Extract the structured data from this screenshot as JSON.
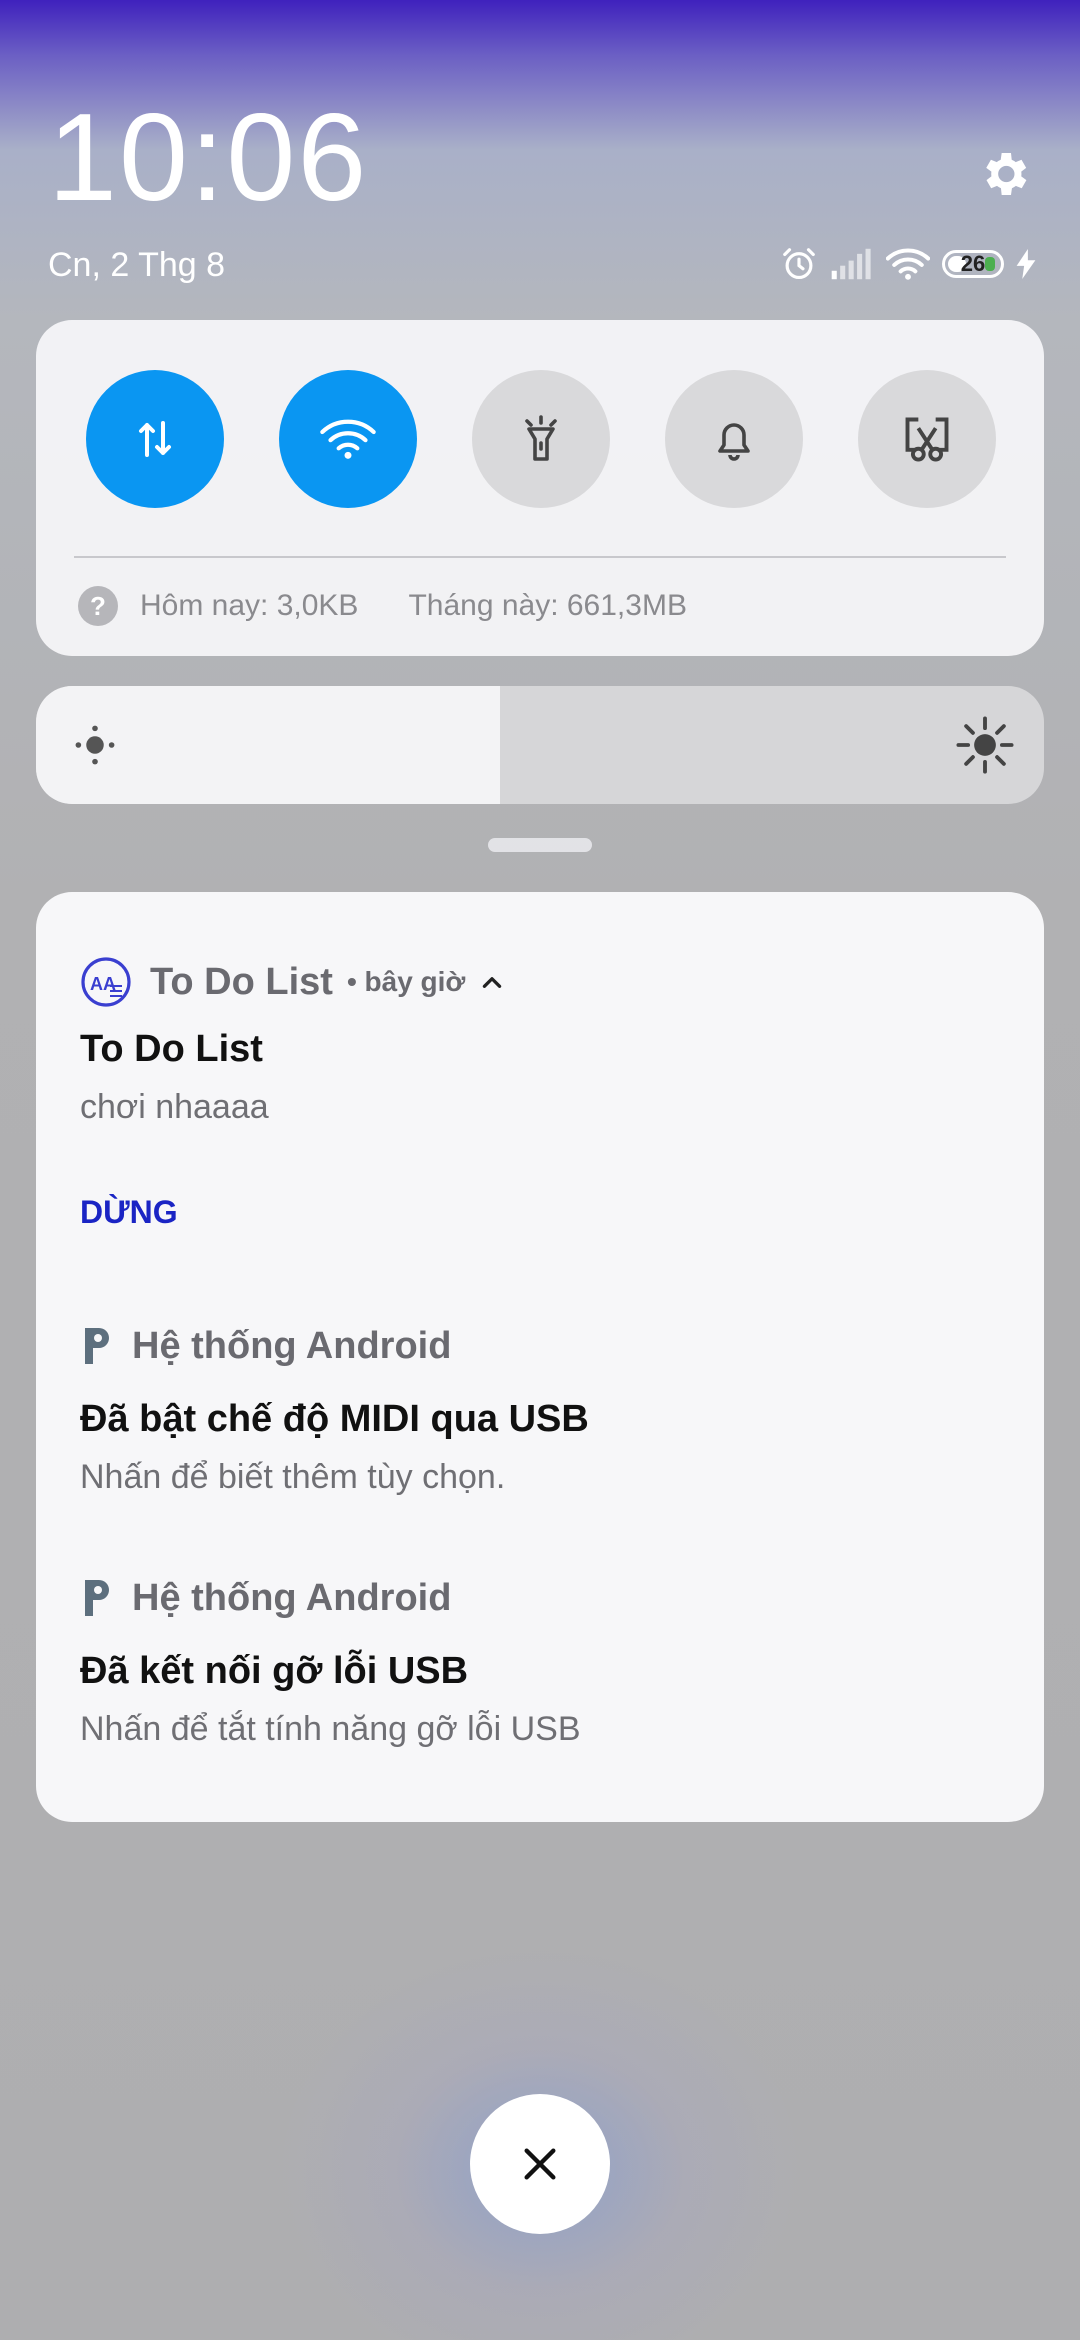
{
  "header": {
    "time": "10:06",
    "date": "Cn, 2 Thg 8",
    "battery_level": "26"
  },
  "quick_settings": {
    "toggles": [
      {
        "name": "mobile-data",
        "icon": "data-arrows-icon",
        "on": true
      },
      {
        "name": "wifi",
        "icon": "wifi-icon",
        "on": true
      },
      {
        "name": "flashlight",
        "icon": "flashlight-icon",
        "on": false
      },
      {
        "name": "notifications-sound",
        "icon": "bell-icon",
        "on": false
      },
      {
        "name": "screenshot",
        "icon": "screenshot-scissors-icon",
        "on": false
      }
    ],
    "usage_today": "Hôm nay: 3,0KB",
    "usage_month": "Tháng này: 661,3MB"
  },
  "brightness": {
    "level": 0.46
  },
  "notifications": [
    {
      "app": "To Do List",
      "time": "• bây giờ",
      "title": "To Do List",
      "body": "chơi nhaaaa",
      "action": "DỪNG"
    },
    {
      "app": "Hệ thống Android",
      "title": "Đã bật chế độ MIDI qua USB",
      "body": "Nhấn để biết thêm tùy chọn."
    },
    {
      "app": "Hệ thống Android",
      "title": "Đã kết nối gỡ lỗi USB",
      "body": "Nhấn để tắt tính năng gỡ lỗi USB"
    }
  ],
  "colors": {
    "accent": "#0a96f2",
    "action": "#1a24c4"
  }
}
